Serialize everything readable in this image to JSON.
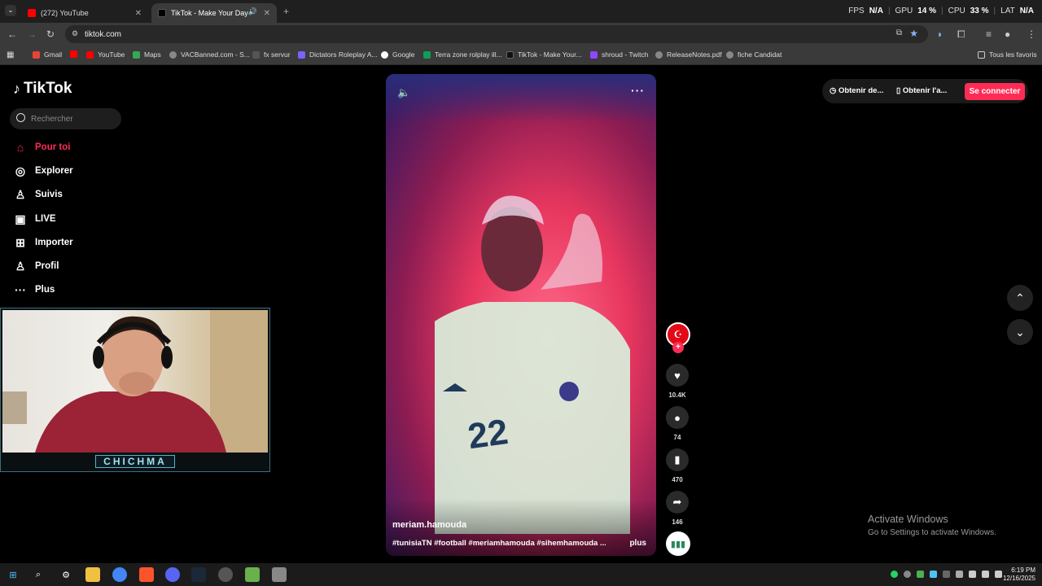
{
  "browser": {
    "tabs": [
      {
        "title": "(272) YouTube",
        "active": false
      },
      {
        "title": "TikTok - Make Your Day",
        "active": true
      }
    ],
    "url": "tiktok.com",
    "perf": {
      "fps_label": "FPS",
      "fps": "N/A",
      "gpu_label": "GPU",
      "gpu": "14 %",
      "cpu_label": "CPU",
      "cpu": "33 %",
      "lat_label": "LAT",
      "lat": "N/A"
    },
    "bookmarks": [
      "Gmail",
      "YouTube",
      "Maps",
      "VACBanned.com - S...",
      "fx servur",
      "Dictators Roleplay A...",
      "Google",
      "Terra zone rolplay ill...",
      "TikTok - Make Your...",
      "shroud - Twitch",
      "ReleaseNotes.pdf",
      "fiche Candidat"
    ],
    "all_bookmarks": "Tous les favoris"
  },
  "tiktok": {
    "logo": "TikTok",
    "search_placeholder": "Rechercher",
    "nav": [
      {
        "label": "Pour toi",
        "icon": "home-icon",
        "active": true
      },
      {
        "label": "Explorer",
        "icon": "compass-icon",
        "active": false
      },
      {
        "label": "Suivis",
        "icon": "following-icon",
        "active": false
      },
      {
        "label": "LIVE",
        "icon": "live-icon",
        "active": false
      },
      {
        "label": "Importer",
        "icon": "upload-icon",
        "active": false
      },
      {
        "label": "Profil",
        "icon": "profile-icon",
        "active": false
      },
      {
        "label": "Plus",
        "icon": "more-icon",
        "active": false
      }
    ],
    "header_right": {
      "get_desktop": "Obtenir de...",
      "get_app": "Obtenir l'a...",
      "login": "Se connecter"
    },
    "video": {
      "author": "meriam.hamouda",
      "caption": "#tunisiaTN #football #meriamhamouda #sihemhamouda ...",
      "more": "plus",
      "jersey_number": "22"
    },
    "actions": {
      "likes": "10.4K",
      "comments": "74",
      "saves": "470",
      "shares": "146"
    }
  },
  "overlay": {
    "streamer_name": "CHICHMA"
  },
  "windows": {
    "activate_title": "Activate Windows",
    "activate_sub": "Go to Settings to activate Windows.",
    "time": "6:19 PM",
    "date": "12/16/2025"
  },
  "colors": {
    "accent": "#fe2c55",
    "chrome_bg": "#3a3a3a"
  }
}
